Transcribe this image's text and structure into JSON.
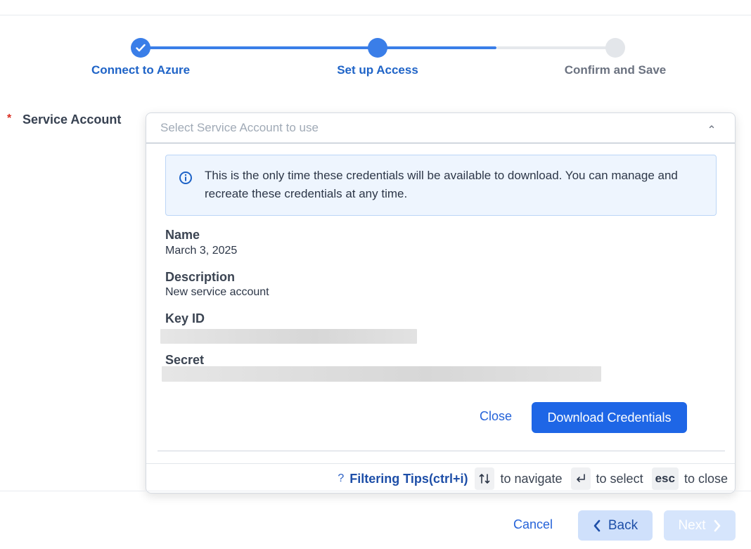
{
  "stepper": {
    "steps": [
      {
        "label": "Connect to Azure",
        "state": "done"
      },
      {
        "label": "Set up Access",
        "state": "current"
      },
      {
        "label": "Confirm and Save",
        "state": "todo"
      }
    ]
  },
  "field": {
    "required_mark": "*",
    "label": "Service Account"
  },
  "dropdown": {
    "placeholder": "Select Service Account to use",
    "info_text": "This is the only time these credentials will be available to download. You can manage and recreate these credentials at any time.",
    "name_label": "Name",
    "name_value": "March 3, 2025",
    "description_label": "Description",
    "description_value": "New service account",
    "key_id_label": "Key ID",
    "secret_label": "Secret",
    "close_label": "Close",
    "download_label": "Download Credentials"
  },
  "footer": {
    "tips_icon": "?",
    "tips_label": "Filtering Tips(ctrl+i)",
    "navigate_text": "to navigate",
    "select_text": "to select",
    "esc_key": "esc",
    "close_text": "to close"
  },
  "actions": {
    "cancel_label": "Cancel",
    "back_label": "Back",
    "next_label": "Next"
  },
  "colors": {
    "accent": "#1e66e6",
    "step_active": "#3a7ee8",
    "required": "#d92d20",
    "info_bg": "#eef5fe"
  }
}
